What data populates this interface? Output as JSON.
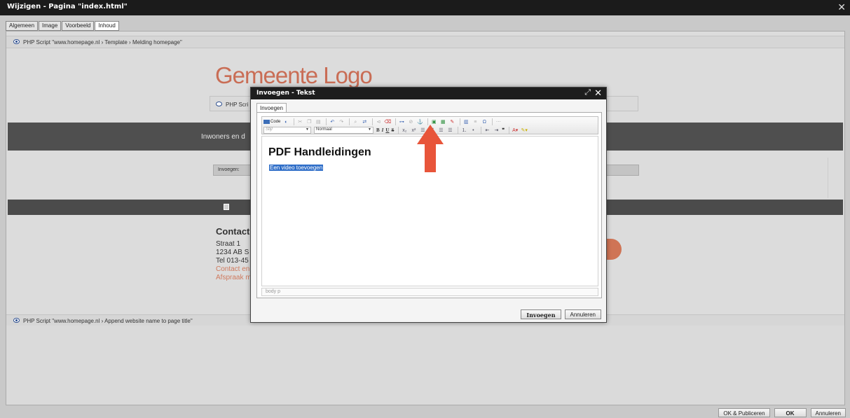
{
  "window": {
    "title": "Wijzigen - Pagina \"index.html\"",
    "close_glyph": "✕"
  },
  "tabs": [
    {
      "label": "Algemeen"
    },
    {
      "label": "Image"
    },
    {
      "label": "Voorbeeld"
    },
    {
      "label": "Inhoud"
    }
  ],
  "page": {
    "script_top": "PHP Script \"www.homepage.nl › Template › Melding homepage\"",
    "logo": "Gemeente Logo",
    "php_box": "PHP Scri",
    "band_text": "Inwoners en d",
    "invoegen_label": "Invoegen:",
    "contact": {
      "heading": "Contact",
      "lines": [
        "Straat 1",
        "1234 AB  S",
        "Tel 013-45"
      ],
      "links": [
        "Contact en",
        "Afspraak m"
      ]
    },
    "script_bottom": "PHP Script \"www.homepage.nl › Append website name to page title\""
  },
  "bottom_buttons": {
    "publish": "OK & Publiceren",
    "ok": "OK",
    "cancel": "Annuleren"
  },
  "modal": {
    "title": "Invoegen - Tekst",
    "maximize_glyph": "⤢",
    "close_glyph": "✕",
    "tab": "Invoegen",
    "toolbar": {
      "code_label": "Code",
      "style_placeholder": "Stijl",
      "format_value": "Normaal",
      "bold": "B",
      "italic": "I",
      "underline": "U",
      "strike": "S"
    },
    "editor": {
      "heading": "PDF Handleidingen",
      "selected_text": "Een video toevoegen"
    },
    "statusbar": "body  p",
    "buttons": {
      "insert": "Invoegen",
      "cancel": "Annuleren"
    }
  },
  "colors": {
    "arrow": "#e8553a",
    "logo": "#c96d55",
    "selection": "#2f6ec8"
  }
}
